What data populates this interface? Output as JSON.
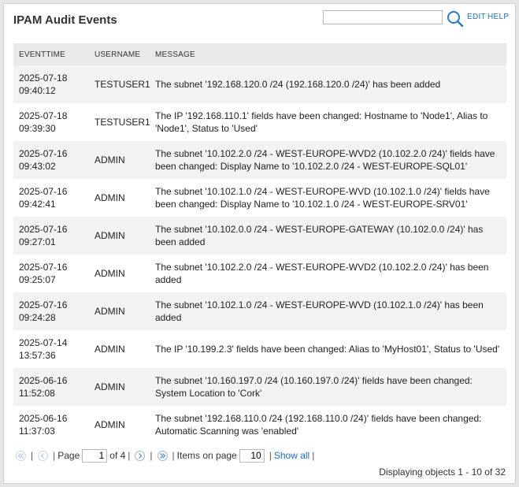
{
  "header": {
    "title": "IPAM Audit Events",
    "search_value": "",
    "edit_label": "EDIT",
    "help_label": "HELP"
  },
  "table": {
    "columns": [
      "EVENTTIME",
      "USERNAME",
      "MESSAGE"
    ],
    "rows": [
      {
        "date": "2025-07-18",
        "time": "09:40:12",
        "user": "TESTUSER1",
        "message": "The subnet '192.168.120.0 /24 (192.168.120.0 /24)' has been added"
      },
      {
        "date": "2025-07-18",
        "time": "09:39:30",
        "user": "TESTUSER1",
        "message": "The IP '192.168.110.1' fields have been changed: Hostname to 'Node1', Alias to 'Node1', Status to 'Used'"
      },
      {
        "date": "2025-07-16",
        "time": "09:43:02",
        "user": "ADMIN",
        "message": "The subnet '10.102.2.0 /24 - WEST-EUROPE-WVD2 (10.102.2.0 /24)' fields have been changed: Display Name to '10.102.2.0 /24 - WEST-EUROPE-SQL01'"
      },
      {
        "date": "2025-07-16",
        "time": "09:42:41",
        "user": "ADMIN",
        "message": "The subnet '10.102.1.0 /24 - WEST-EUROPE-WVD (10.102.1.0 /24)' fields have been changed: Display Name to '10.102.1.0 /24 - WEST-EUROPE-SRV01'"
      },
      {
        "date": "2025-07-16",
        "time": "09:27:01",
        "user": "ADMIN",
        "message": "The subnet '10.102.0.0 /24 - WEST-EUROPE-GATEWAY (10.102.0.0 /24)' has been added"
      },
      {
        "date": "2025-07-16",
        "time": "09:25:07",
        "user": "ADMIN",
        "message": "The subnet '10.102.2.0 /24 - WEST-EUROPE-WVD2 (10.102.2.0 /24)' has been added"
      },
      {
        "date": "2025-07-16",
        "time": "09:24:28",
        "user": "ADMIN",
        "message": "The subnet '10.102.1.0 /24 - WEST-EUROPE-WVD (10.102.1.0 /24)' has been added"
      },
      {
        "date": "2025-07-14",
        "time": "13:57:36",
        "user": "ADMIN",
        "message": "The IP '10.199.2.3' fields have been changed: Alias to 'MyHost01', Status to 'Used'"
      },
      {
        "date": "2025-06-16",
        "time": "11:52:08",
        "user": "ADMIN",
        "message": "The subnet '10.160.197.0 /24 (10.160.197.0 /24)' fields have been changed: System Location to 'Cork'"
      },
      {
        "date": "2025-06-16",
        "time": "11:37:03",
        "user": "ADMIN",
        "message": "The subnet '192.168.110.0 /24 (192.168.110.0 /24)' fields have been changed: Automatic Scanning was 'enabled'"
      }
    ]
  },
  "pager": {
    "page_label": "Page",
    "page_value": "1",
    "of_label": "of 4",
    "items_label": "Items on page",
    "items_value": "10",
    "show_all_label": "Show all",
    "status": "Displaying objects 1 - 10 of 32"
  },
  "icons": {
    "search": "search-icon",
    "first": "first-page-icon",
    "prev": "prev-page-icon",
    "next": "next-page-icon",
    "last": "last-page-icon"
  },
  "colors": {
    "link": "#1f6fb5",
    "header_bg": "#e9e9e9",
    "alt_row_bg": "#f2f2f2"
  }
}
